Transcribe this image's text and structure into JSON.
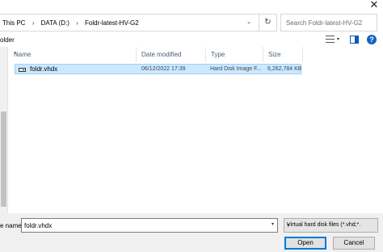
{
  "window": {
    "close_glyph": "✕"
  },
  "address": {
    "crumbs": [
      "This PC",
      "DATA (D:)",
      "Foldr-latest-HV-G2"
    ],
    "separator": "›",
    "dropdown_glyph": "⌄",
    "refresh_glyph": "↻",
    "search_placeholder": "Search Foldr-latest-HV-G2"
  },
  "toolbar": {
    "new_folder_label": "older",
    "view_dd_glyph": "▾",
    "help_glyph": "?"
  },
  "list": {
    "columns": [
      {
        "label": "Name"
      },
      {
        "label": "Date modified"
      },
      {
        "label": "Type"
      },
      {
        "label": "Size"
      }
    ],
    "sort_glyph": "^",
    "rows": [
      {
        "name": "foldr.vhdx",
        "date": "06/12/2022 17:39",
        "type": "Hard Disk Image F...",
        "size": "6,262,784 KB",
        "selected": true
      }
    ]
  },
  "bottom": {
    "filename_label": "e name:",
    "filename_value": "foldr.vhdx",
    "filename_dd_glyph": "▾",
    "filetype_value": "Virtual hard disk files  (*.vhd;*.",
    "filetype_dd_glyph": "▾",
    "open_label": "Open",
    "cancel_label": "Cancel"
  },
  "colors": {
    "selection_bg": "#cce8ff",
    "selection_border": "#99d1ff",
    "header_text": "#4c607a",
    "accent": "#0078d7"
  }
}
